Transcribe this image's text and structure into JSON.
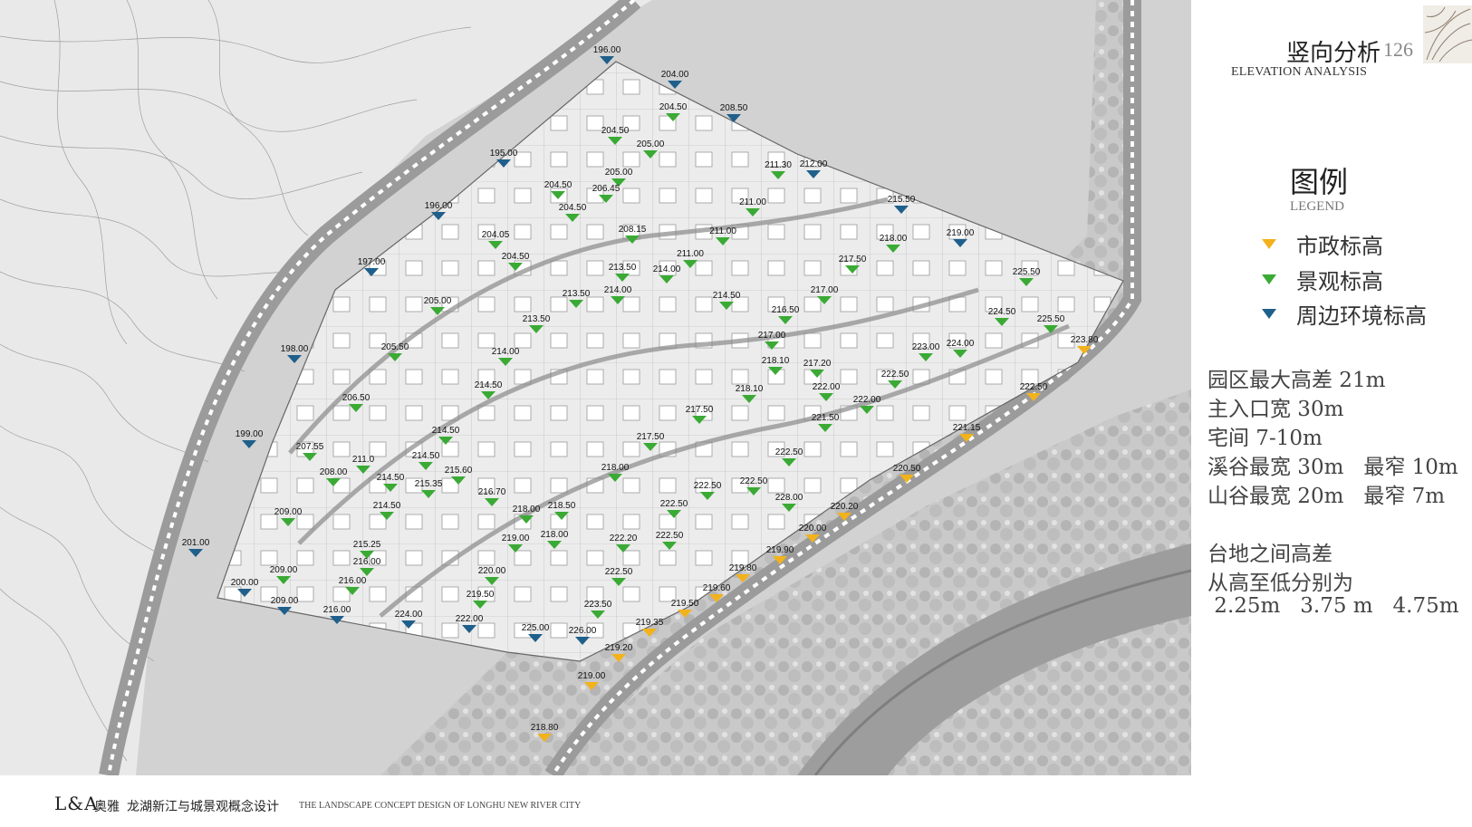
{
  "header": {
    "title_cn": "竖向分析",
    "page_number": "126",
    "title_en": "ELEVATION ANALYSIS"
  },
  "legend": {
    "title_cn": "图例",
    "title_en": "LEGEND",
    "items": [
      {
        "label": "市政标高",
        "color": "#f2b21b",
        "icon": "triangle-down-icon"
      },
      {
        "label": "景观标高",
        "color": "#3aaa35",
        "icon": "triangle-down-icon"
      },
      {
        "label": "周边环境标高",
        "color": "#1f5f8b",
        "icon": "triangle-down-icon"
      }
    ]
  },
  "stats": {
    "lines": [
      "园区最大高差 21m",
      "主入口宽 30m",
      "宅间 7-10m",
      "溪谷最宽 30m   最窄 10m",
      "山谷最宽 20m   最窄 7m"
    ],
    "terrace_lines": [
      "台地之间高差",
      "从高至低分别为",
      " 2.25m   3.75 m   4.75m"
    ]
  },
  "footer": {
    "logo": "L&A",
    "brand": "奥雅",
    "project_cn": "龙湖新江与城景观概念设计",
    "project_en": "THE LANDSCAPE CONCEPT DESIGN OF LONGHU NEW RIVER CITY"
  },
  "colors": {
    "municipal": "#f2b21b",
    "landscape": "#3aaa35",
    "surrounding": "#1f5f8b"
  },
  "markers": {
    "surrounding": [
      "196.00",
      "204.00",
      "208.50",
      "195.00",
      "212.00",
      "215.50",
      "196.00",
      "219.00",
      "197.00",
      "198.00",
      "199.00",
      "201.00",
      "200.00",
      "209.00",
      "216.00",
      "224.00",
      "222.00",
      "225.00",
      "226.00"
    ],
    "landscape": [
      "204.50",
      "204.50",
      "205.00",
      "205.00",
      "211.30",
      "204.50",
      "206.45",
      "204.50",
      "211.00",
      "208.15",
      "204.05",
      "211.00",
      "204.50",
      "211.00",
      "213.50",
      "214.00",
      "218.00",
      "217.50",
      "205.00",
      "213.50",
      "214.00",
      "214.50",
      "217.00",
      "225.50",
      "216.50",
      "224.50",
      "225.50",
      "213.50",
      "217.00",
      "205.50",
      "214.00",
      "218.10",
      "217.20",
      "223.00",
      "224.00",
      "222.50",
      "214.50",
      "218.10",
      "222.00",
      "222.00",
      "206.50",
      "217.50",
      "221.50",
      "214.50",
      "207.55",
      "214.50",
      "217.50",
      "211.0",
      "208.00",
      "215.60",
      "214.50",
      "215.35",
      "218.00",
      "222.50",
      "216.70",
      "218.00",
      "218.50",
      "222.50",
      "222.50",
      "209.00",
      "214.50",
      "228.00",
      "218.00",
      "222.50",
      "219.00",
      "222.20",
      "215.25",
      "216.00",
      "222.50",
      "209.00",
      "216.00",
      "220.00",
      "222.50",
      "219.50",
      "223.50"
    ],
    "municipal": [
      "223.80",
      "222.50",
      "221.15",
      "220.50",
      "220.20",
      "220.00",
      "219.90",
      "219.80",
      "219.60",
      "219.50",
      "219.35",
      "219.20",
      "219.00",
      "218.80"
    ]
  }
}
